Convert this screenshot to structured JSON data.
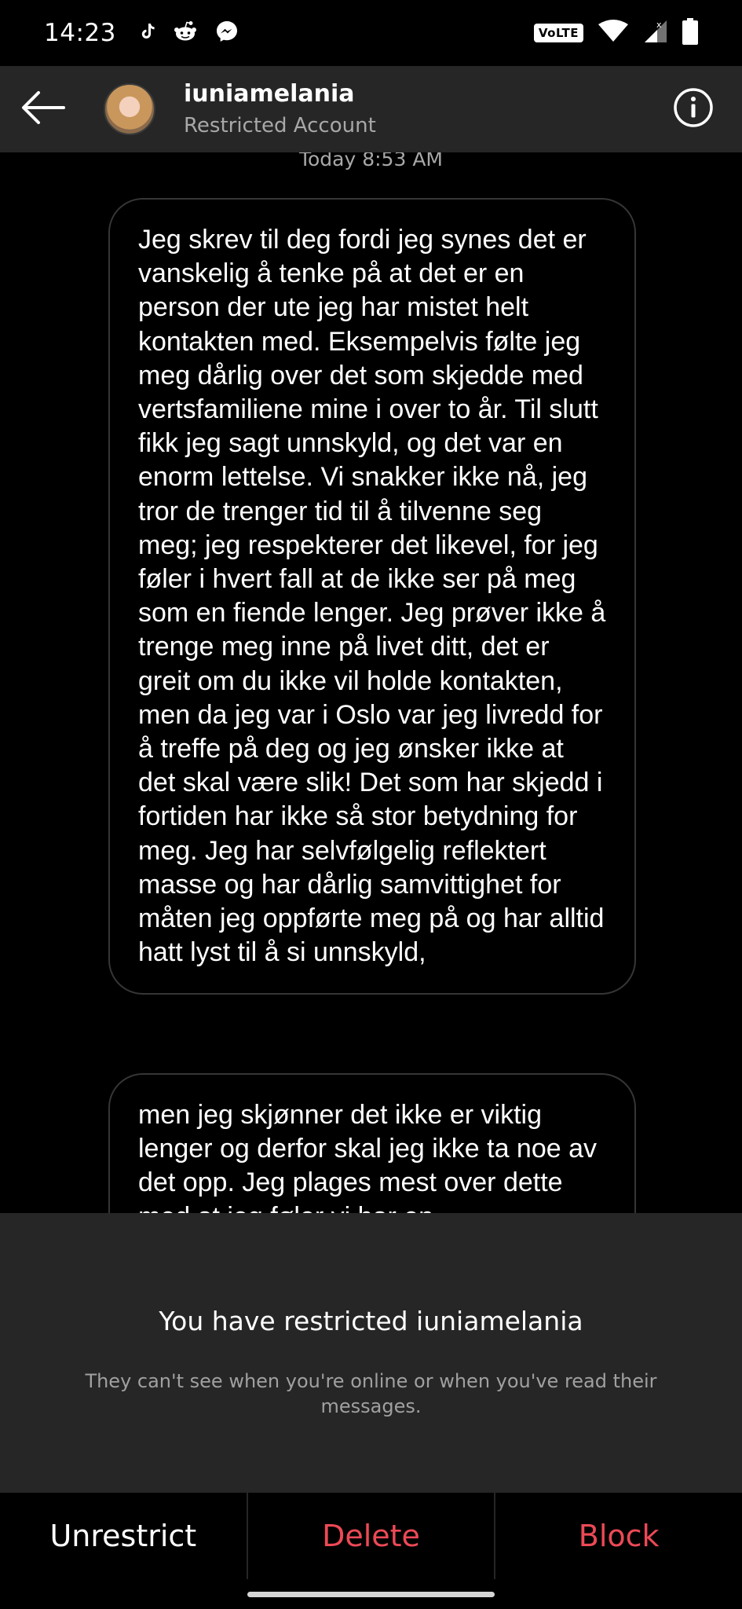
{
  "status_bar": {
    "time": "14:23",
    "apps": [
      "tiktok-icon",
      "reddit-icon",
      "messenger-icon"
    ],
    "network_badge": "VoLTE",
    "icons": [
      "wifi-icon",
      "signal-icon",
      "battery-icon"
    ]
  },
  "header": {
    "username": "iuniamelania",
    "subtitle": "Restricted Account",
    "back_icon": "arrow-left-icon",
    "info_icon": "info-icon"
  },
  "chat": {
    "timestamp": "Today 8:53 AM",
    "messages": [
      {
        "text": "Jeg skrev til deg fordi jeg synes det er vanskelig å tenke på at det er en person der ute jeg har mistet helt kontakten med. Eksempelvis følte jeg meg dårlig over det som skjedde med vertsfamiliene mine i over to år. Til slutt fikk jeg sagt unnskyld, og det var en enorm lettelse. Vi snakker ikke nå, jeg tror de trenger tid til å tilvenne seg meg; jeg respekterer det likevel, for jeg føler i hvert fall at de ikke ser på meg som en fiende lenger. Jeg prøver ikke å trenge meg inne på livet ditt, det er greit om du ikke vil holde kontakten, men da jeg var i Oslo var jeg livredd for å treffe på deg og jeg ønsker ikke at det skal være slik! Det som har skjedd i fortiden har ikke så stor betydning for meg. Jeg har selvfølgelig reflektert masse og har dårlig samvittighet for måten jeg oppførte meg på og har alltid hatt lyst til å si unnskyld,"
      },
      {
        "text": "men jeg skjønner det ikke er viktig lenger og derfor skal jeg ikke ta noe av det opp. Jeg plages mest over dette med at jeg føler vi har en"
      }
    ]
  },
  "restrict_panel": {
    "title": "You have restricted iuniamelania",
    "description": "They can't see when you're online or when you've read their messages."
  },
  "actions": {
    "unrestrict": "Unrestrict",
    "delete": "Delete",
    "block": "Block"
  },
  "colors": {
    "background": "#000000",
    "panel": "#262626",
    "danger": "#ED4956",
    "secondary_text": "#A8A8A8"
  }
}
